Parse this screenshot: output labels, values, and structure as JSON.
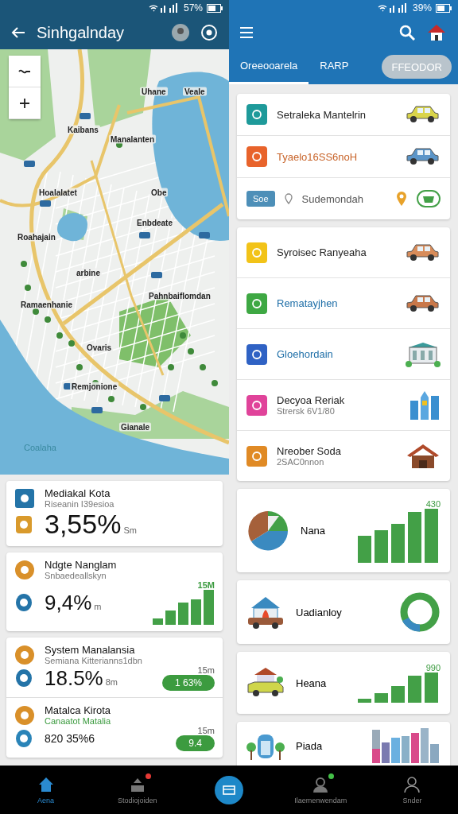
{
  "left_panel": {
    "status_bar": {
      "battery": "57%"
    },
    "app_bar": {
      "title": "Sinhgalnday"
    },
    "map_labels": [
      "Uhane",
      "Veale",
      "Kaibans",
      "Manalanten",
      "Hoalalatet",
      "Obe",
      "Enbdeate",
      "Roahajain",
      "arbine",
      "Pahnbaiflomdan",
      "Ramaenhanie",
      "Ovaris",
      "Remjonione",
      "Gianale",
      "Coalaha"
    ],
    "stat_groups": [
      [
        {
          "kind": "big",
          "title": "Mediakal Kota",
          "subtitle": "Riseanin I39esioa",
          "value": "3,55%",
          "unit": "Sm"
        }
      ],
      [
        {
          "kind": "bars",
          "title": "Ndgte Nanglam",
          "subtitle": "Snbaedeallskyn",
          "value": "9,4%",
          "unit": "m",
          "badge": "15M"
        }
      ],
      [
        {
          "kind": "pill",
          "title": "System Manalansia",
          "subtitle": "Semiana Kitterianns1dbn",
          "value": "18.5%",
          "unit": "8m",
          "time": "15m",
          "pill": "1 63%"
        },
        {
          "kind": "pill",
          "title": "Matalca Kirota",
          "subtitle": "Canaatot Matalia",
          "value": "820 35%6",
          "time": "15m",
          "pill": "9.4"
        }
      ]
    ]
  },
  "right_panel": {
    "status_bar": {
      "battery": "39%"
    },
    "tabs": [
      {
        "label": "Oreeooarela",
        "kind": "tab",
        "selected": true
      },
      {
        "label": "RARP",
        "kind": "tab",
        "selected": false
      },
      {
        "label": "FFEODOR",
        "kind": "chip",
        "selected": false
      }
    ],
    "list_groups": [
      [
        {
          "kind": "item",
          "title": "Setraleka Mantelrin",
          "color": "#1e9a9a"
        },
        {
          "kind": "item",
          "title": "Tyaelo16SS6noH",
          "color": "#e8632b"
        },
        {
          "kind": "chip-row",
          "chip": "Soe",
          "title": "Sudemondah"
        }
      ],
      [
        {
          "kind": "item",
          "title": "Syroisec Ranyeaha",
          "color": "#f2c318"
        },
        {
          "kind": "item",
          "title": "Rematayjhen",
          "color": "#3ea843"
        },
        {
          "kind": "item",
          "title": "Gloehordain",
          "color": "#2f62c4"
        },
        {
          "kind": "item",
          "title": "Decyoa Reriak",
          "subtitle": "Strersk 6V1/80",
          "color": "#e0439a"
        },
        {
          "kind": "item",
          "title": "Nreober Soda",
          "subtitle": "2SAC0nnon",
          "color": "#e08a25"
        }
      ]
    ],
    "chart_cards": [
      {
        "kind": "bars",
        "title": "Nana",
        "value": "430"
      },
      {
        "kind": "donut",
        "title": "Uadianloy"
      },
      {
        "kind": "bars",
        "title": "Heana",
        "value": "990"
      },
      {
        "kind": "city",
        "title": "Piada"
      }
    ]
  },
  "bottom_nav": [
    {
      "kind": "tab",
      "label": "Aena",
      "selected": true
    },
    {
      "kind": "tab",
      "label": "Stodiojoiden",
      "selected": false,
      "color": "#e53935"
    },
    {
      "kind": "fab",
      "selected": false
    },
    {
      "kind": "tab",
      "label": "Ilaemenwendam",
      "selected": false,
      "color": "#43c047"
    },
    {
      "kind": "tab",
      "label": "Snder",
      "selected": false
    }
  ]
}
